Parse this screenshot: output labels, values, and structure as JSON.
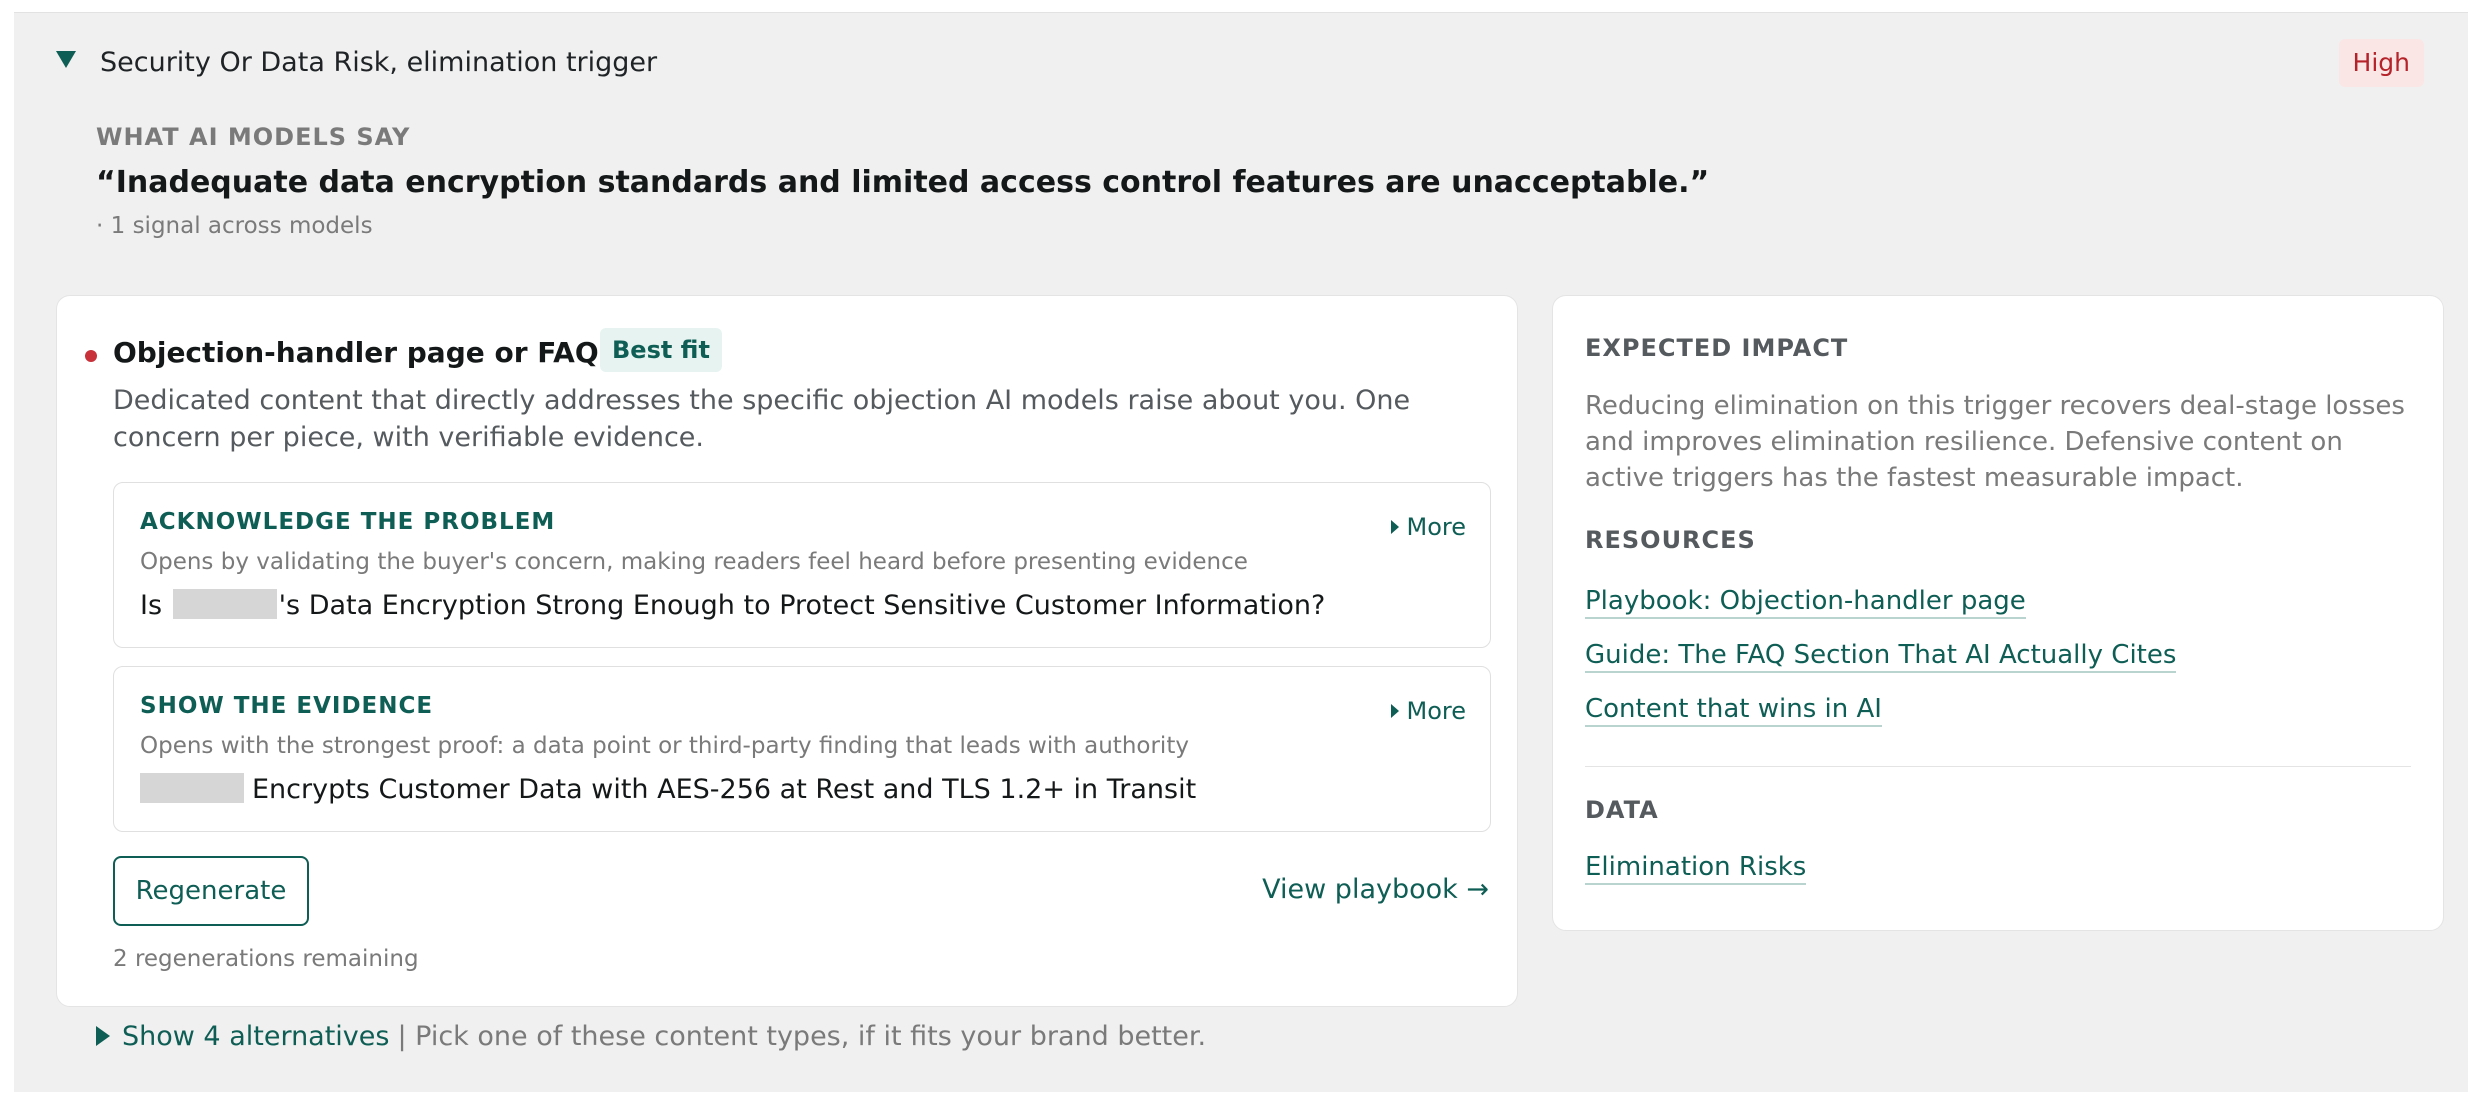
{
  "trigger": {
    "title": "Security Or Data Risk, elimination trigger",
    "severity": "High"
  },
  "models_say": {
    "label": "WHAT AI MODELS SAY",
    "quote": "“Inadequate data encryption standards and limited access control features are unacceptable.”",
    "signal_count": "· 1 signal across models"
  },
  "recommendation": {
    "title": "Objection-handler page or FAQ page",
    "badge": "Best fit",
    "description": "Dedicated content that directly addresses the specific objection AI models raise about you. One concern per piece, with verifiable evidence.",
    "steps": [
      {
        "label": "ACKNOWLEDGE THE PROBLEM",
        "more": "More",
        "sub": "Opens by validating the buyer's concern, making readers feel heard before presenting evidence",
        "headline_prefix": "Is",
        "headline_suffix": "'s Data Encryption Strong Enough to Protect Sensitive Customer Information?"
      },
      {
        "label": "SHOW THE EVIDENCE",
        "more": "More",
        "sub": "Opens with the strongest proof: a data point or third-party finding that leads with authority",
        "headline_suffix": "Encrypts Customer Data with AES-256 at Rest and TLS 1.2+ in Transit"
      }
    ],
    "regenerate_label": "Regenerate",
    "view_playbook": "View playbook →",
    "regenerations_remaining": "2 regenerations remaining"
  },
  "impact": {
    "label": "EXPECTED IMPACT",
    "text": "Reducing elimination on this trigger recovers deal-stage losses and improves elimination resilience. Defensive content on active triggers has the fastest measurable impact.",
    "resources_label": "RESOURCES",
    "resources": [
      "Playbook: Objection-handler page",
      "Guide: The FAQ Section That AI Actually Cites",
      "Content that wins in AI"
    ],
    "data_label": "DATA",
    "data_links": [
      "Elimination Risks"
    ]
  },
  "alternatives": {
    "link": "Show 4 alternatives",
    "note": "| Pick one of these content types, if it fits your brand better."
  },
  "colors": {
    "accent": "#0f5e55",
    "severity_high": "#b4232a",
    "severity_bg": "#fbe6e6",
    "panel_bg": "#f0f0f0"
  }
}
